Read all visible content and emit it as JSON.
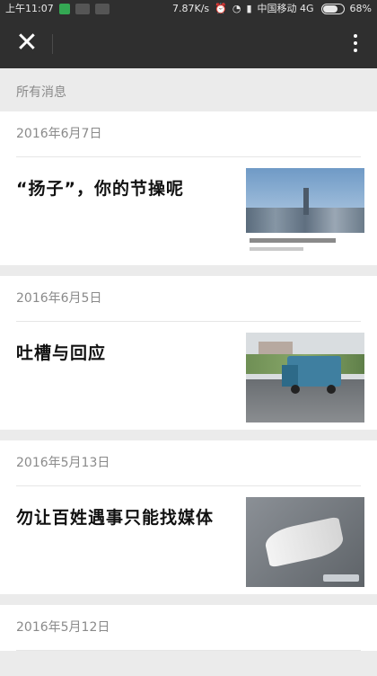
{
  "status_bar": {
    "time": "上午11:07",
    "speed": "7.87K/s",
    "carrier": "中国移动 4G",
    "battery_percent": "68%",
    "battery_level": 0.68
  },
  "header": {
    "close_icon": "close-icon",
    "menu_icon": "more-vertical-icon"
  },
  "section_label": "所有消息",
  "articles": [
    {
      "date": "2016年6月7日",
      "title": "“扬子”，你的节操呢"
    },
    {
      "date": "2016年6月5日",
      "title": "吐槽与回应"
    },
    {
      "date": "2016年5月13日",
      "title": "勿让百姓遇事只能找媒体"
    },
    {
      "date": "2016年5月12日",
      "title": ""
    }
  ],
  "colors": {
    "title_bar": "#2f2f2f",
    "page_bg": "#ebebeb",
    "card_bg": "#ffffff",
    "date_text": "#8a8a8a"
  }
}
